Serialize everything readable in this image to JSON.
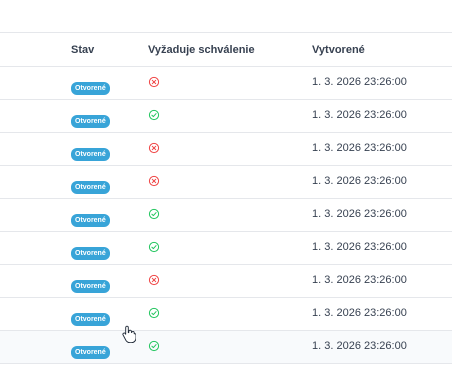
{
  "table": {
    "columns": {
      "status": "Stav",
      "approval": "Vyžaduje schválenie",
      "created": "Vytvorené"
    },
    "rows": [
      {
        "status": "Otvorené",
        "requires_approval": false,
        "created": "1. 3. 2026 23:26:00"
      },
      {
        "status": "Otvorené",
        "requires_approval": true,
        "created": "1. 3. 2026 23:26:00"
      },
      {
        "status": "Otvorené",
        "requires_approval": false,
        "created": "1. 3. 2026 23:26:00"
      },
      {
        "status": "Otvorené",
        "requires_approval": false,
        "created": "1. 3. 2026 23:26:00"
      },
      {
        "status": "Otvorené",
        "requires_approval": true,
        "created": "1. 3. 2026 23:26:00"
      },
      {
        "status": "Otvorené",
        "requires_approval": true,
        "created": "1. 3. 2026 23:26:00"
      },
      {
        "status": "Otvorené",
        "requires_approval": false,
        "created": "1. 3. 2026 23:26:00"
      },
      {
        "status": "Otvorené",
        "requires_approval": true,
        "created": "1. 3. 2026 23:26:00"
      },
      {
        "status": "Otvorené",
        "requires_approval": true,
        "created": "1. 3. 2026 23:26:00"
      }
    ]
  },
  "colors": {
    "badge": "#38a4d8",
    "yes": "#22c55e",
    "no": "#ef4444",
    "hover_row": "#f8fafc"
  },
  "icons": {
    "yes": "check-circle-icon",
    "no": "x-circle-icon",
    "cursor": "hand-pointer-icon"
  }
}
